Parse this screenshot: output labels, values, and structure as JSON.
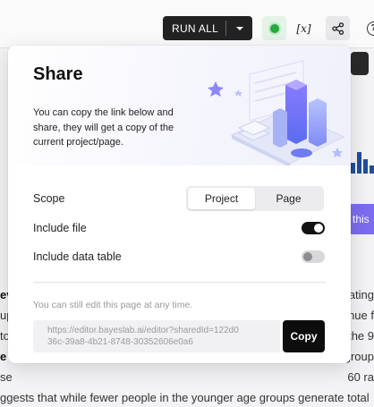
{
  "toolbar": {
    "run_all_label": "RUN ALL",
    "variables_label": "[x]",
    "help_label": "?"
  },
  "background": {
    "purple_button_label": "this",
    "text_rows": [
      {
        "left": "ev",
        "right": "cating"
      },
      {
        "left": "up",
        "right": "nue f"
      },
      {
        "left": "to",
        "right": "the 9"
      },
      {
        "left": "e",
        "right": "group"
      },
      {
        "left": "se",
        "right": "60 ra"
      },
      {
        "left": "ggests that while fewer people in the younger age groups generate total",
        "right": ""
      }
    ]
  },
  "share": {
    "title": "Share",
    "description": "You can copy the link below and share, they will get a copy of the current project/page.",
    "scope_label": "Scope",
    "scope_options": [
      "Project",
      "Page"
    ],
    "scope_selected": "Project",
    "include_file_label": "Include file",
    "include_file_on": true,
    "include_table_label": "Include data table",
    "include_table_on": false,
    "note": "You can still edit this page at any time.",
    "link_line1": "https://editor.bayeslab.ai/editor?sharedId=122d0",
    "link_line2": "36c-39a8-4b21-8748-30352606e0a6",
    "copy_label": "Copy"
  },
  "colors": {
    "accent_purple": "#7b6cf0",
    "status_green": "#22aa3a",
    "dark": "#111111"
  }
}
